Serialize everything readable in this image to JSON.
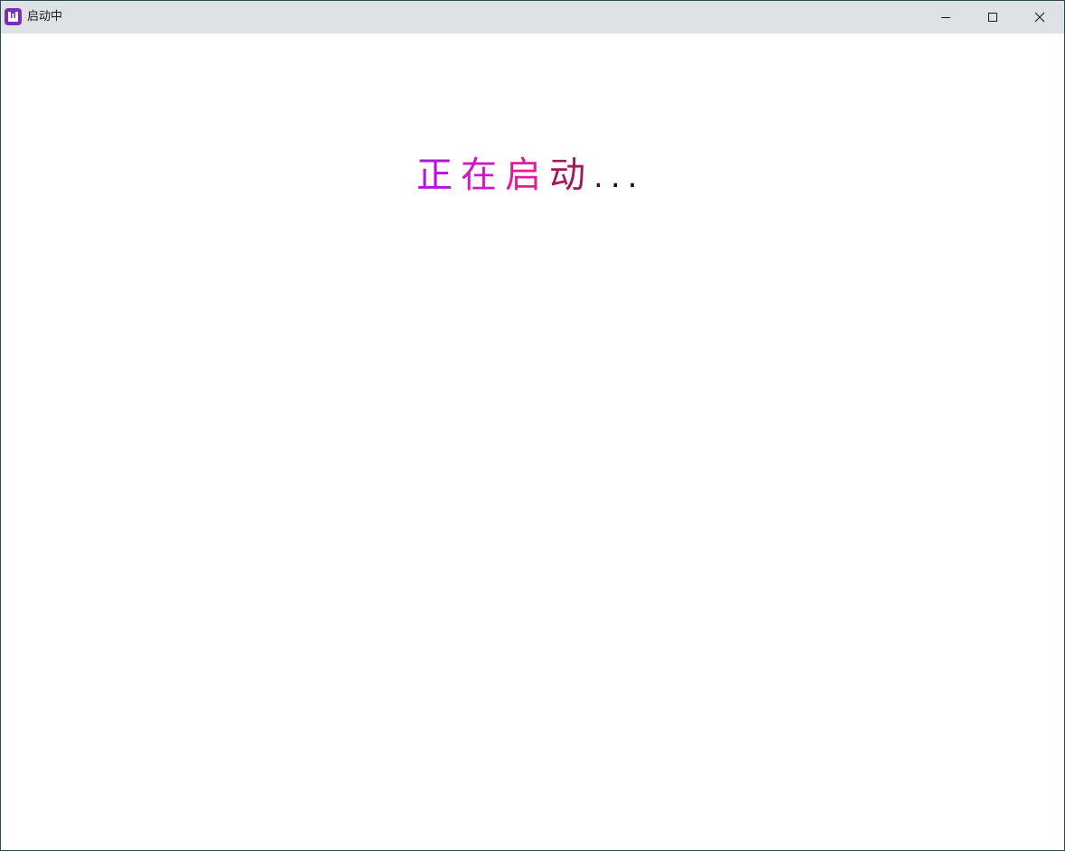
{
  "window": {
    "title": "启动中",
    "icon": "app-logo-icon",
    "controls": {
      "minimize_icon": "minimize-icon",
      "maximize_icon": "maximize-icon",
      "close_icon": "close-icon"
    }
  },
  "loading": {
    "chars": [
      "正",
      "在",
      "启",
      "动"
    ],
    "dots": [
      ".",
      ".",
      "."
    ],
    "colors": [
      "#b312e0",
      "#cc19c4",
      "#e01c9b",
      "#a0185f",
      "#4a0c1f",
      "#2a0811",
      "#160307"
    ]
  }
}
